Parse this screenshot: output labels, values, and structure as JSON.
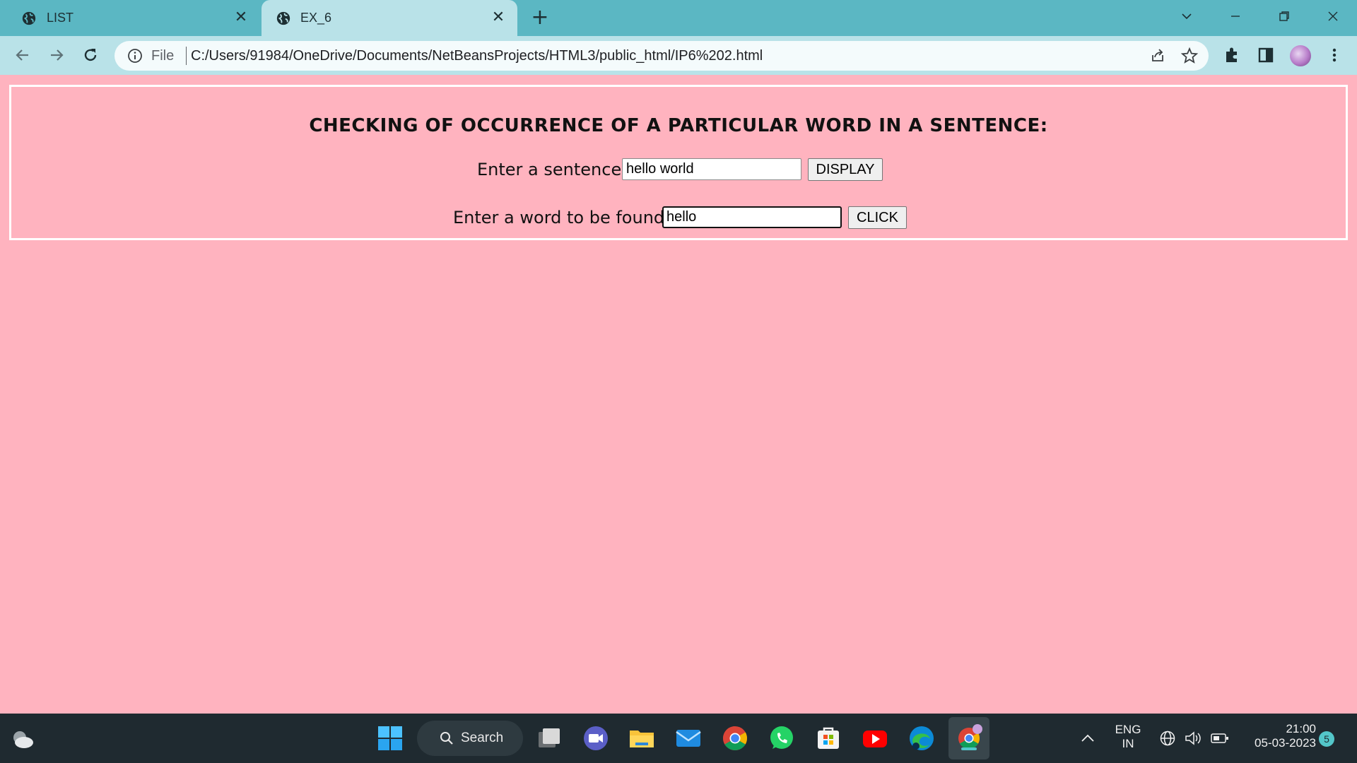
{
  "browser": {
    "tabs": [
      {
        "title": "LIST",
        "active": false
      },
      {
        "title": "EX_6",
        "active": true
      }
    ],
    "address": {
      "scheme_label": "File",
      "url": "C:/Users/91984/OneDrive/Documents/NetBeansProjects/HTML3/public_html/IP6%202.html"
    }
  },
  "page": {
    "background_color": "#ffb3bf",
    "heading": "CHECKING OF OCCURRENCE OF A PARTICULAR WORD IN A SENTENCE:",
    "sentence_row": {
      "label": "Enter a sentence:",
      "value": "hello world",
      "button_label": "DISPLAY"
    },
    "word_row": {
      "label": "Enter a word to be found:",
      "value": "hello",
      "button_label": "CLICK"
    }
  },
  "taskbar": {
    "search_label": "Search",
    "language": "ENG",
    "region": "IN",
    "time": "21:00",
    "date": "05-03-2023",
    "notification_count": "5",
    "apps": [
      "start-icon",
      "task-view-icon",
      "teams-icon",
      "file-explorer-icon",
      "mail-icon",
      "chrome-icon",
      "whatsapp-icon",
      "store-icon",
      "youtube-icon",
      "edge-icon",
      "chrome-profile-icon"
    ]
  }
}
